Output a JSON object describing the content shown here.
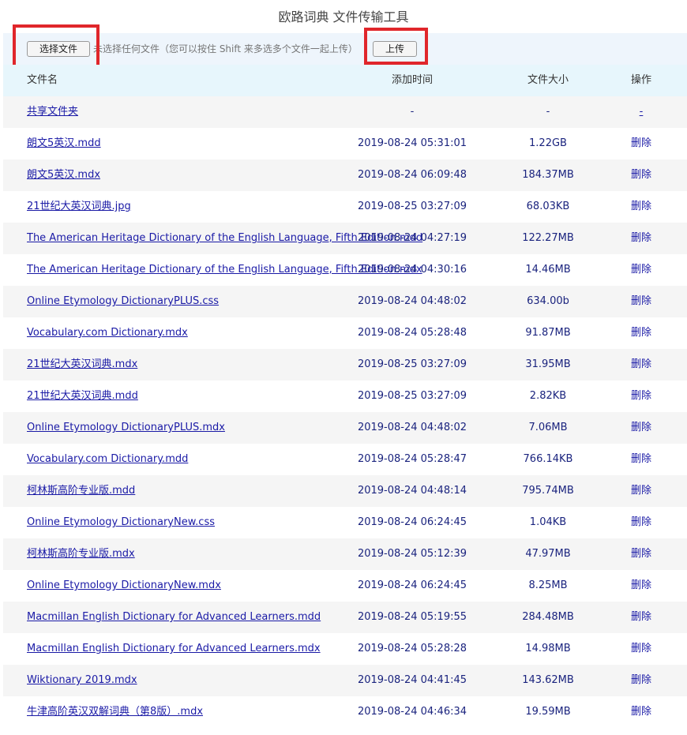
{
  "page": {
    "title": "欧路词典 文件传输工具"
  },
  "upload": {
    "choose_label": "选择文件",
    "status_text": "未选择任何文件（您可以按住 Shift 来多选多个文件一起上传）",
    "upload_label": "上传"
  },
  "table": {
    "headers": {
      "name": "文件名",
      "time": "添加时间",
      "size": "文件大小",
      "op": "操作"
    },
    "rows": [
      {
        "name": "共享文件夹",
        "time": "-",
        "size": "-",
        "op": "-"
      },
      {
        "name": "朗文5英汉.mdd",
        "time": "2019-08-24 05:31:01",
        "size": "1.22GB",
        "op": "删除"
      },
      {
        "name": "朗文5英汉.mdx",
        "time": "2019-08-24 06:09:48",
        "size": "184.37MB",
        "op": "删除"
      },
      {
        "name": "21世纪大英汉词典.jpg",
        "time": "2019-08-25 03:27:09",
        "size": "68.03KB",
        "op": "删除"
      },
      {
        "name": "The American Heritage Dictionary of the English Language, Fifth Edition.mdd",
        "time": "2019-08-24 04:27:19",
        "size": "122.27MB",
        "op": "删除"
      },
      {
        "name": "The American Heritage Dictionary of the English Language, Fifth Edition.mdx",
        "time": "2019-08-24 04:30:16",
        "size": "14.46MB",
        "op": "删除"
      },
      {
        "name": "Online Etymology DictionaryPLUS.css",
        "time": "2019-08-24 04:48:02",
        "size": "634.00b",
        "op": "删除"
      },
      {
        "name": "Vocabulary.com Dictionary.mdx",
        "time": "2019-08-24 05:28:48",
        "size": "91.87MB",
        "op": "删除"
      },
      {
        "name": "21世纪大英汉词典.mdx",
        "time": "2019-08-25 03:27:09",
        "size": "31.95MB",
        "op": "删除"
      },
      {
        "name": "21世纪大英汉词典.mdd",
        "time": "2019-08-25 03:27:09",
        "size": "2.82KB",
        "op": "删除"
      },
      {
        "name": "Online Etymology DictionaryPLUS.mdx",
        "time": "2019-08-24 04:48:02",
        "size": "7.06MB",
        "op": "删除"
      },
      {
        "name": "Vocabulary.com Dictionary.mdd",
        "time": "2019-08-24 05:28:47",
        "size": "766.14KB",
        "op": "删除"
      },
      {
        "name": "柯林斯高阶专业版.mdd",
        "time": "2019-08-24 04:48:14",
        "size": "795.74MB",
        "op": "删除"
      },
      {
        "name": "Online Etymology DictionaryNew.css",
        "time": "2019-08-24 06:24:45",
        "size": "1.04KB",
        "op": "删除"
      },
      {
        "name": "柯林斯高阶专业版.mdx",
        "time": "2019-08-24 05:12:39",
        "size": "47.97MB",
        "op": "删除"
      },
      {
        "name": "Online Etymology DictionaryNew.mdx",
        "time": "2019-08-24 06:24:45",
        "size": "8.25MB",
        "op": "删除"
      },
      {
        "name": "Macmillan English Dictionary for Advanced Learners.mdd",
        "time": "2019-08-24 05:19:55",
        "size": "284.48MB",
        "op": "删除"
      },
      {
        "name": "Macmillan English Dictionary for Advanced Learners.mdx",
        "time": "2019-08-24 05:28:28",
        "size": "14.98MB",
        "op": "删除"
      },
      {
        "name": "Wiktionary 2019.mdx",
        "time": "2019-08-24 04:41:45",
        "size": "143.62MB",
        "op": "删除"
      },
      {
        "name": "牛津高阶英汉双解词典（第8版）.mdx",
        "time": "2019-08-24 04:46:34",
        "size": "19.59MB",
        "op": "删除"
      }
    ]
  },
  "colors": {
    "link": "#1a1aa6",
    "highlight": "#e0262b",
    "header_bg": "#e7f6fc",
    "upload_bg": "#eef5fc"
  }
}
